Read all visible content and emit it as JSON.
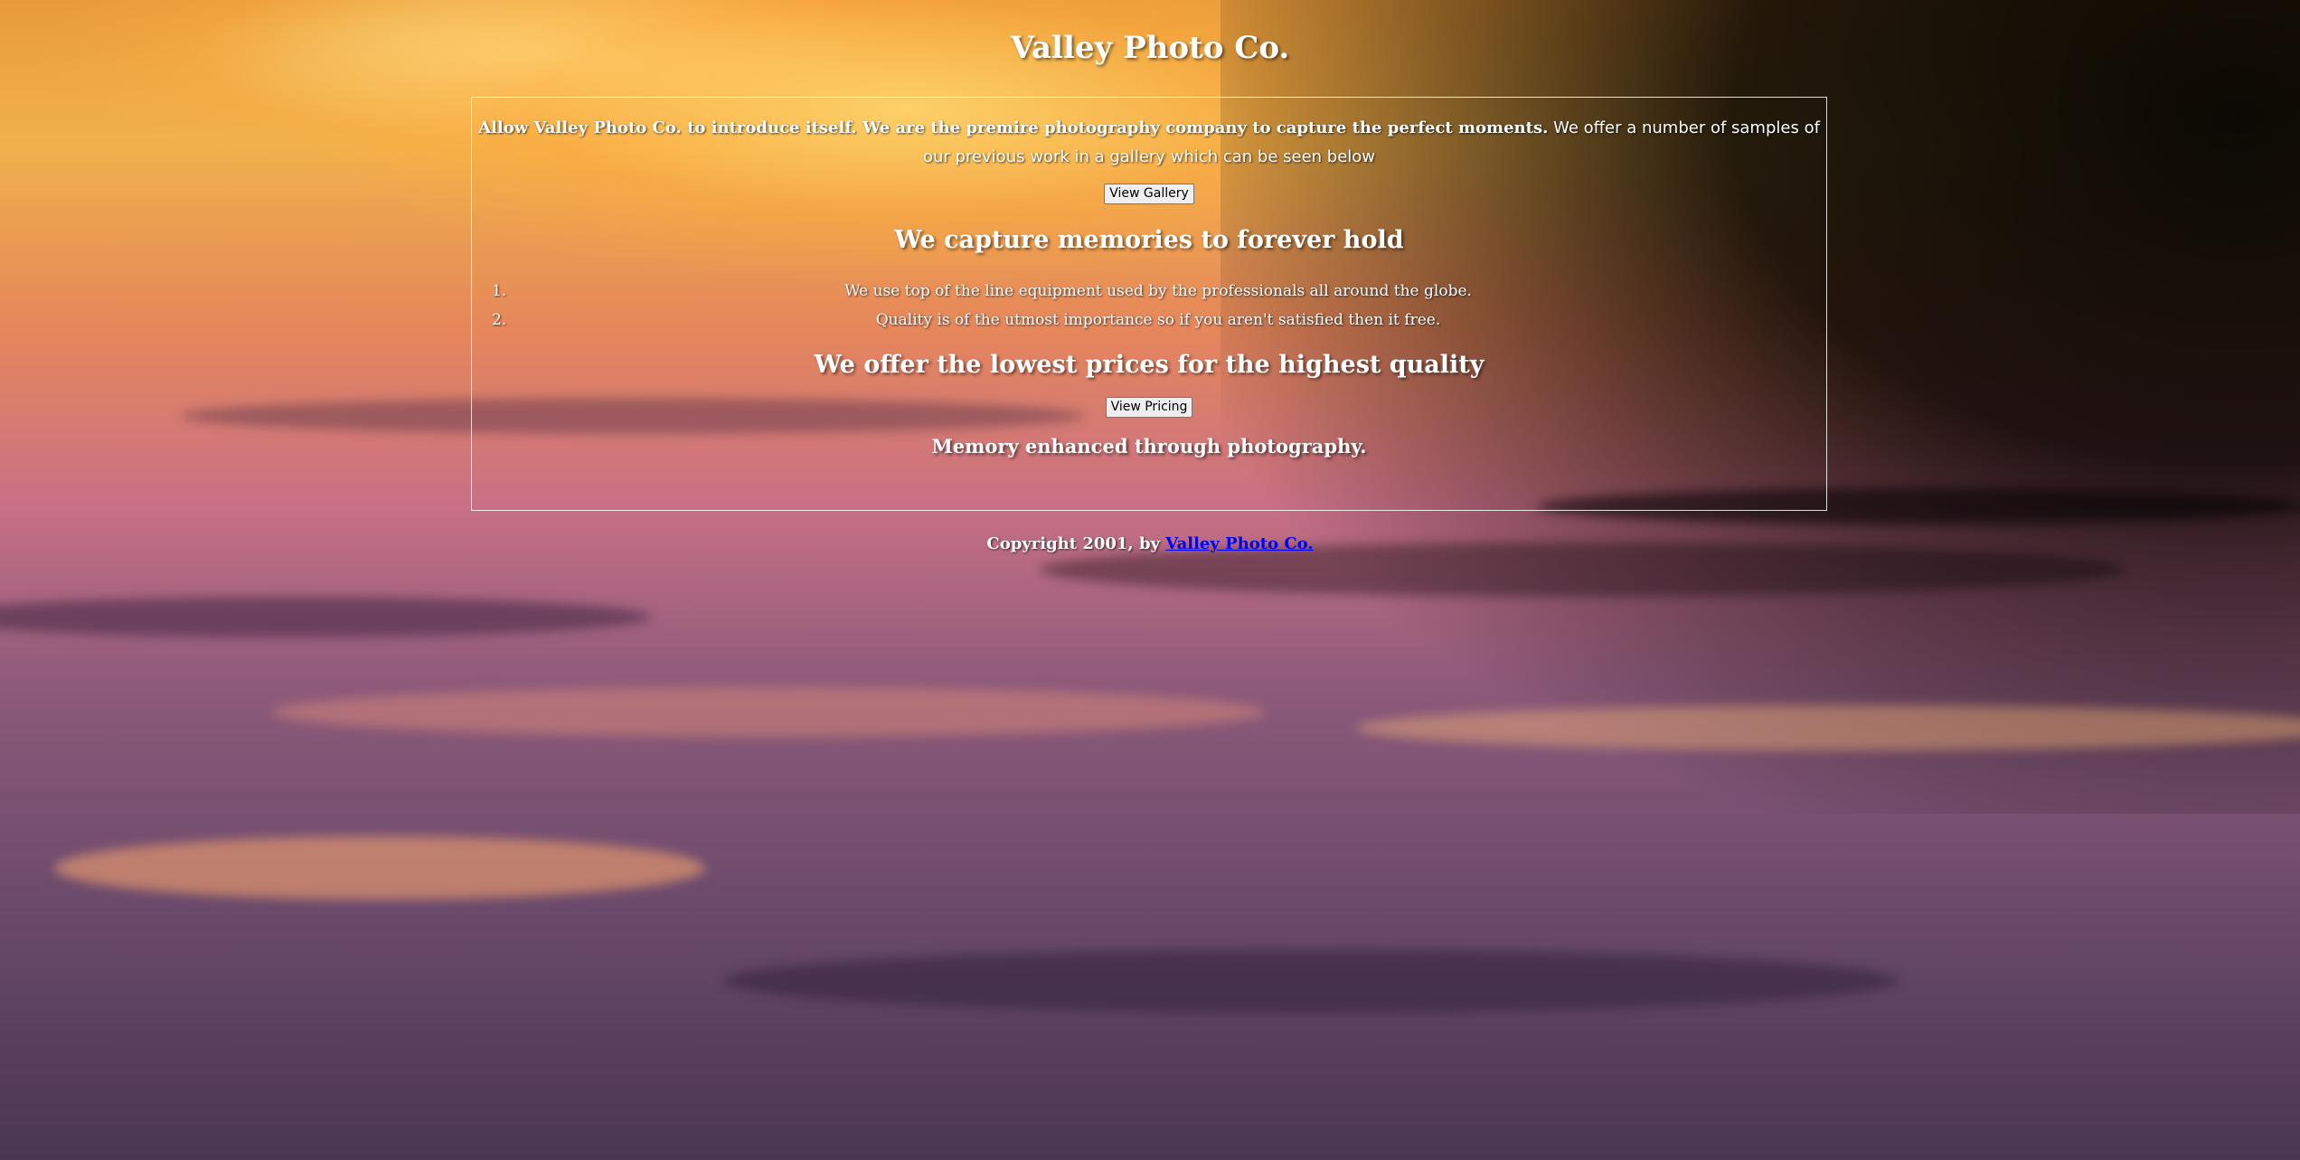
{
  "site": {
    "title": "Valley Photo Co."
  },
  "intro": {
    "bold_text": "Allow Valley Photo Co. to introduce itself. We are the premire photography company to capture the perfect moments.",
    "plain_text": " We offer a number of samples of our previous work in a gallery which can be seen below"
  },
  "buttons": {
    "gallery_label": "View Gallery",
    "pricing_label": "View Pricing"
  },
  "sections": {
    "memories_heading": "We capture memories to forever hold",
    "features": [
      {
        "num": "1.",
        "text": "We use top of the line equipment used by the professionals all around the globe."
      },
      {
        "num": "2.",
        "text": "Quality is of the utmost importance so if you aren't satisfied then it free."
      }
    ],
    "pricing_heading": "We offer the lowest prices for the highest quality",
    "tagline": "Memory enhanced through photography."
  },
  "footer": {
    "prefix": "Copyright 2001, by ",
    "link_text": "Valley Photo Co."
  },
  "colors": {
    "text": "#ffffff",
    "link": "#0000ee",
    "button_bg": "#efefef",
    "sunset_orange": "#f0b14c",
    "water_purple": "#6b4a6c"
  }
}
